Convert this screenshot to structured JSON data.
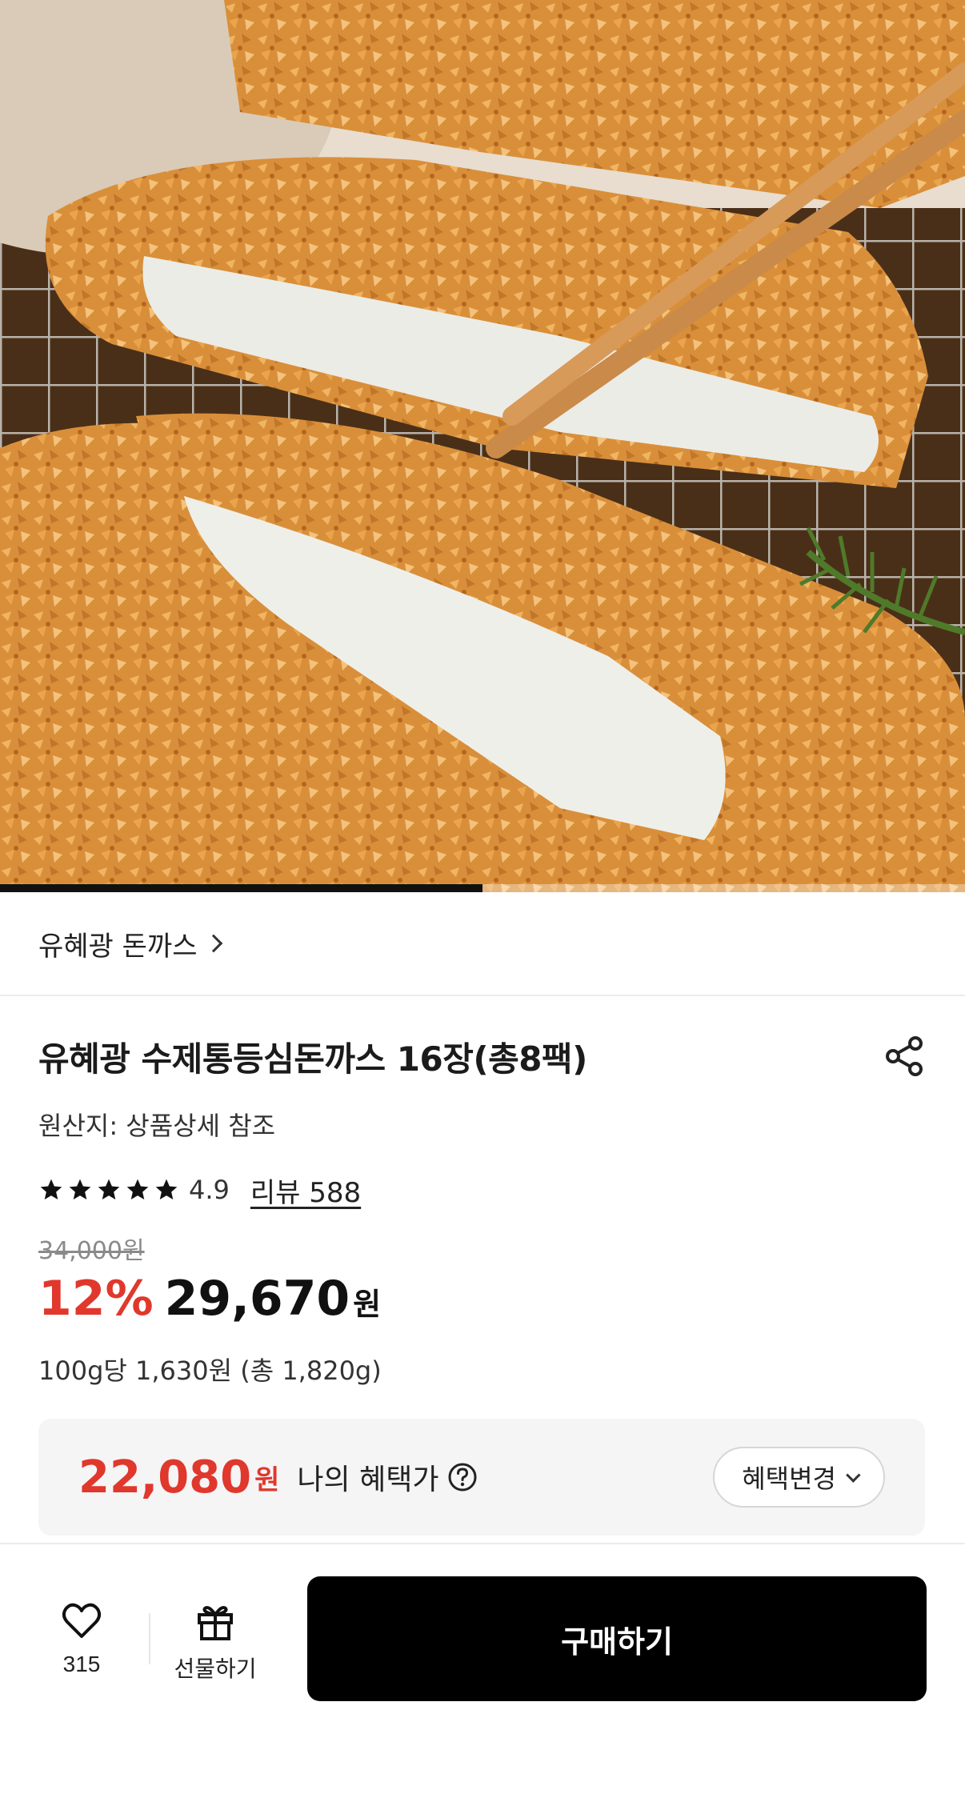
{
  "hero": {
    "image_icon": "pork-cutlet-photo",
    "carousel_progress": 0.5
  },
  "brand": {
    "name": "유혜광 돈까스",
    "chevron_icon": "chevron-right-icon"
  },
  "product": {
    "title": "유혜광 수제통등심돈까스 16장(총8팩)",
    "share_icon": "share-icon",
    "origin": "원산지: 상품상세 참조",
    "rating": {
      "stars": 5,
      "score": "4.9",
      "review_label": "리뷰 588"
    },
    "original_price": "34,000원",
    "discount": "12%",
    "sale_price": "29,670",
    "currency": "원",
    "unit_price": "100g당 1,630원 (총 1,820g)"
  },
  "benefit": {
    "price": "22,080",
    "currency": "원",
    "label": "나의 혜택가",
    "help_icon": "question-circle-icon",
    "change_button": "혜택변경"
  },
  "bottom_bar": {
    "like_count": "315",
    "like_icon": "heart-icon",
    "gift_label": "선물하기",
    "gift_icon": "gift-icon",
    "buy_label": "구매하기"
  },
  "colors": {
    "accent_red": "#e0382c",
    "buy_button": "#000000",
    "benefit_bg": "#f5f5f6"
  }
}
